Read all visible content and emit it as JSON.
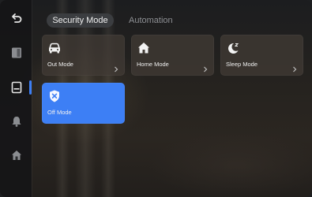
{
  "sidebar": {
    "items": [
      {
        "icon": "back-arrow-icon"
      },
      {
        "icon": "door-panel-icon"
      },
      {
        "icon": "tablet-icon",
        "active": true
      },
      {
        "icon": "bell-icon"
      },
      {
        "icon": "home-icon"
      }
    ],
    "active_color": "#3d7ff5"
  },
  "tabs": [
    {
      "label": "Security Mode",
      "active": true
    },
    {
      "label": "Automation",
      "active": false
    }
  ],
  "modes": [
    {
      "label": "Out Mode",
      "icon": "car-icon",
      "active": false
    },
    {
      "label": "Home Mode",
      "icon": "house-icon",
      "active": false
    },
    {
      "label": "Sleep Mode",
      "icon": "moon-icon",
      "active": false
    },
    {
      "label": "Off Mode",
      "icon": "shield-off-icon",
      "active": true
    }
  ],
  "colors": {
    "accent": "#3d7ff5",
    "card": "#423c36",
    "text": "#f0f0f0"
  }
}
